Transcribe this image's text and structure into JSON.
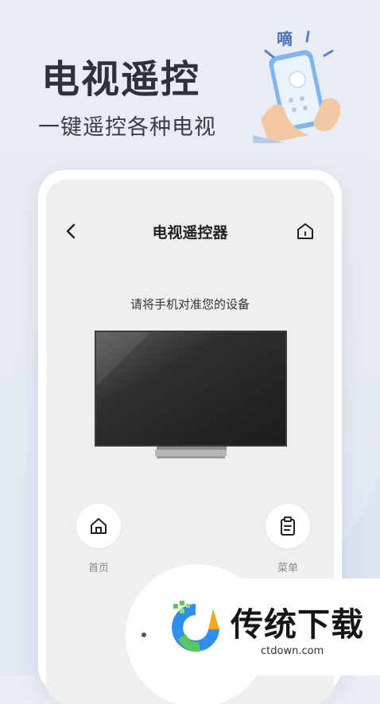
{
  "promo": {
    "title": "电视遥控",
    "subtitle": "一键遥控各种电视",
    "deco_text": "嘀"
  },
  "screen": {
    "title": "电视遥控器",
    "instruction": "请将手机对准您的设备"
  },
  "buttons": {
    "home_label": "首页",
    "menu_label": "菜单"
  },
  "icons": {
    "back": "chevron-left-icon",
    "home_top": "home-icon",
    "home": "home-icon",
    "menu": "clipboard-icon"
  },
  "watermark": {
    "name": "传统下载",
    "url": "ctdown.com"
  },
  "colors": {
    "background": "#e9edf4",
    "screen": "#efefef",
    "accent_blue": "#2f8ff0",
    "accent_green": "#5cc85a",
    "accent_orange": "#f5a623"
  }
}
